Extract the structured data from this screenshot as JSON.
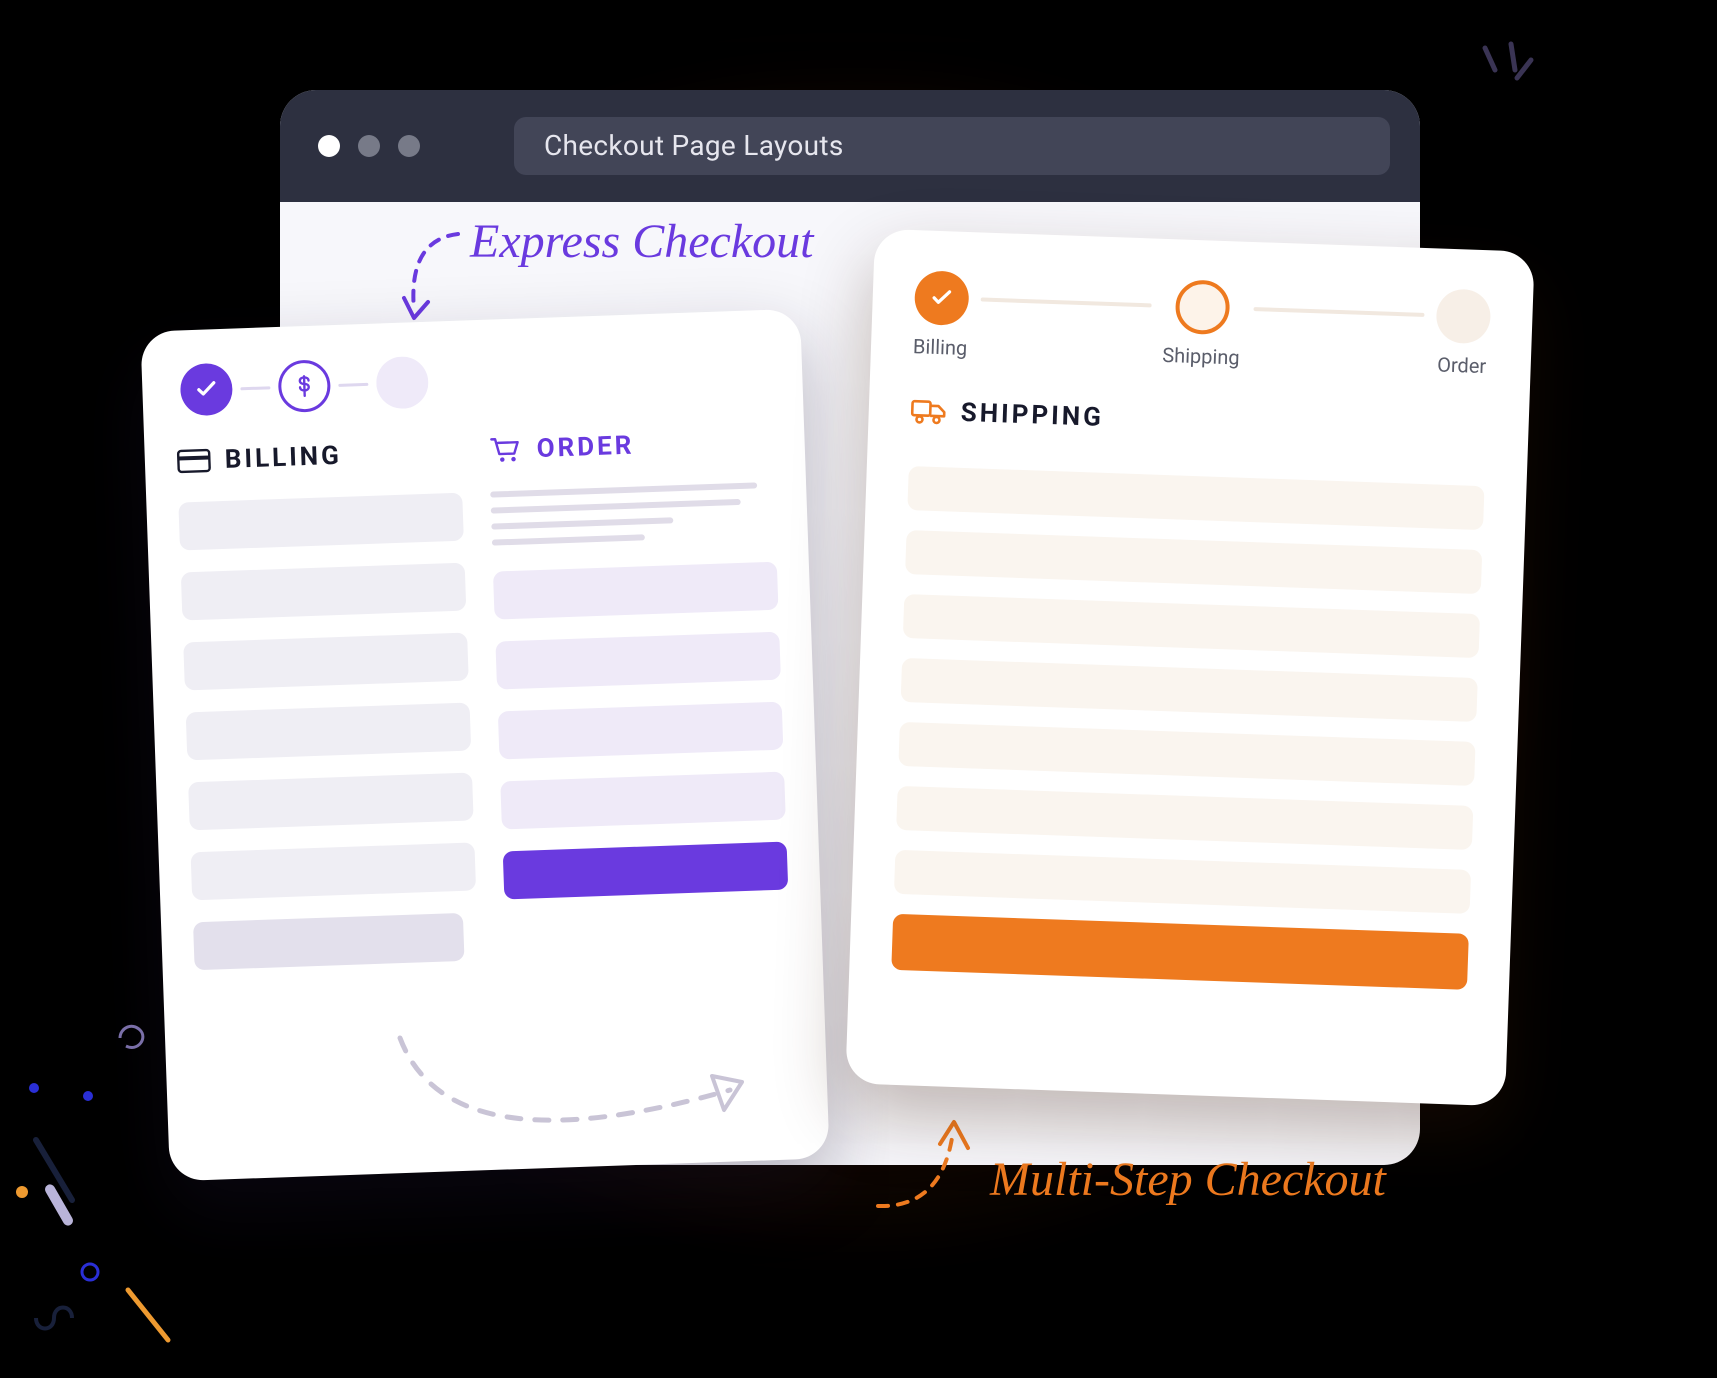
{
  "frame": {
    "title": "Checkout Page Layouts"
  },
  "annotations": {
    "express": "Express Checkout",
    "multistep": "Multi-Step Checkout"
  },
  "express_card": {
    "billing_title": "BILLING",
    "order_title": "ORDER"
  },
  "multi_card": {
    "steps": {
      "billing": "Billing",
      "shipping": "Shipping",
      "order": "Order"
    },
    "section_title": "SHIPPING"
  },
  "colors": {
    "purple": "#6a3adf",
    "orange": "#ee7a1f",
    "frame_bar": "#2d3040"
  }
}
